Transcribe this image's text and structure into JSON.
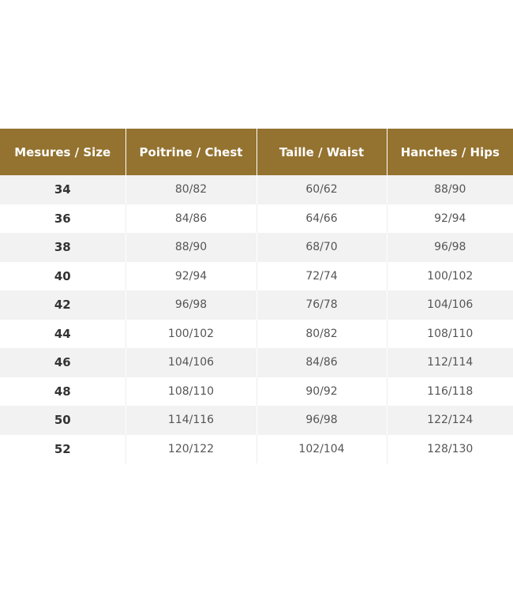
{
  "table": {
    "headers": [
      "Mesures / Size",
      "Poitrine / Chest",
      "Taille / Waist",
      "Hanches / Hips"
    ],
    "rows": [
      [
        "34",
        "80/82",
        "60/62",
        "88/90"
      ],
      [
        "36",
        "84/86",
        "64/66",
        "92/94"
      ],
      [
        "38",
        "88/90",
        "68/70",
        "96/98"
      ],
      [
        "40",
        "92/94",
        "72/74",
        "100/102"
      ],
      [
        "42",
        "96/98",
        "76/78",
        "104/106"
      ],
      [
        "44",
        "100/102",
        "80/82",
        "108/110"
      ],
      [
        "46",
        "104/106",
        "84/86",
        "112/114"
      ],
      [
        "48",
        "108/110",
        "90/92",
        "116/118"
      ],
      [
        "50",
        "114/116",
        "96/98",
        "122/124"
      ],
      [
        "52",
        "120/122",
        "102/104",
        "128/130"
      ]
    ]
  },
  "colors": {
    "header_bg": "#94722f",
    "header_text": "#ffffff",
    "stripe": "#f2f2f2"
  }
}
